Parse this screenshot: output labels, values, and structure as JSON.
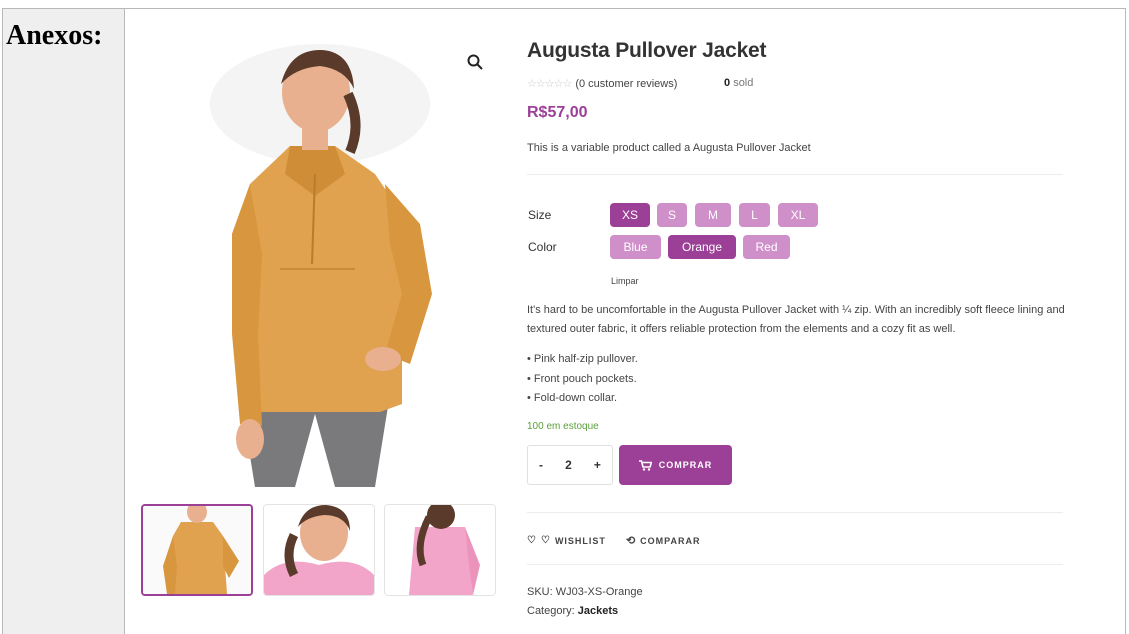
{
  "doc": {
    "label": "Anexos:"
  },
  "product": {
    "title": "Augusta Pullover Jacket",
    "reviews": "(0 customer reviews)",
    "sold_count": "0",
    "sold_label": "sold",
    "price": "R$57,00",
    "short_description": "This is a variable product called a Augusta Pullover Jacket",
    "size_label": "Size",
    "sizes": [
      "XS",
      "S",
      "M",
      "L",
      "XL"
    ],
    "selected_size": "XS",
    "color_label": "Color",
    "colors": [
      "Blue",
      "Orange",
      "Red"
    ],
    "selected_color": "Orange",
    "clear_label": "Limpar",
    "long_description": "It's hard to be uncomfortable in the Augusta Pullover Jacket with ¼ zip. With an incredibly soft fleece lining and textured outer fabric, it offers reliable protection from the elements and a cozy fit as well.",
    "bullets": [
      "• Pink half-zip pullover.",
      "• Front pouch pockets.",
      "• Fold-down collar."
    ],
    "stock": "100 em estoque",
    "quantity": "2",
    "minus": "-",
    "plus": "+",
    "buy_label": "COMPRAR",
    "wishlist_label": "WISHLIST",
    "compare_label": "COMPARAR",
    "sku_label": "SKU:",
    "sku": "WJ03-XS-Orange",
    "category_label": "Category:",
    "category": "Jackets"
  },
  "colors": {
    "accent": "#9b3f97",
    "accent_light": "#cf8fc9",
    "stock_green": "#5aa03b",
    "jacket_orange": "#e0a24e",
    "jacket_pink": "#f3a4c9"
  },
  "icons": [
    "search-icon",
    "star-icon",
    "cart-icon",
    "heart-icon",
    "compare-icon"
  ]
}
